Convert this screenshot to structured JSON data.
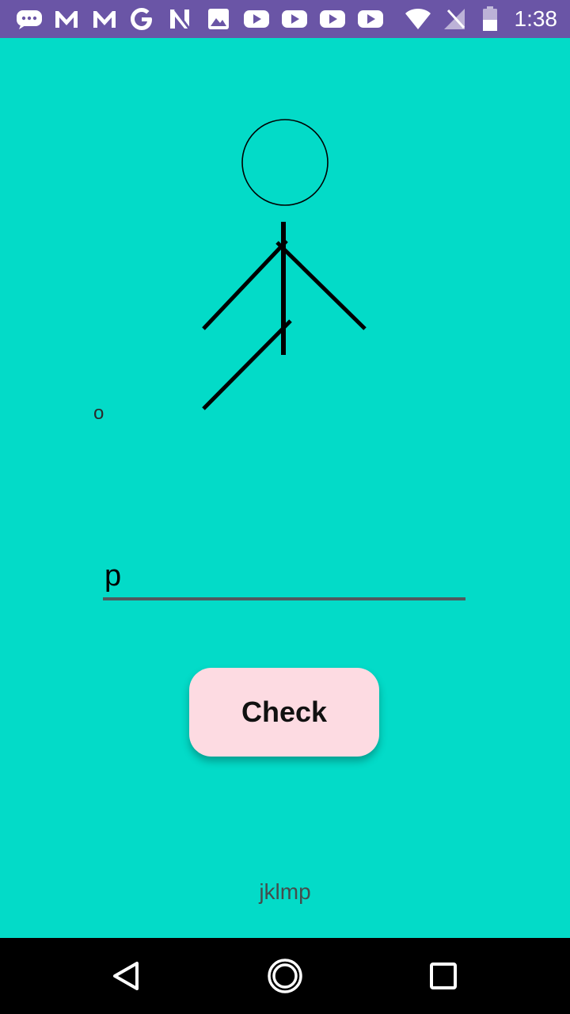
{
  "status_bar": {
    "time": "1:38",
    "icons": [
      "messages-icon",
      "gmail-icon",
      "gmail-icon",
      "google-icon",
      "n-app-icon",
      "gallery-icon",
      "youtube-icon",
      "youtube-icon",
      "youtube-icon",
      "youtube-icon",
      "wifi-icon",
      "no-signal-icon",
      "battery-icon"
    ]
  },
  "game": {
    "guessed_letters": "o",
    "input_value": "p",
    "check_label": "Check",
    "word_display": "jklmp"
  },
  "nav_bar": {
    "icons": [
      "back-icon",
      "home-icon",
      "recents-icon"
    ]
  },
  "colors": {
    "background": "#03dbc8",
    "status_bar": "#6a55a6",
    "button": "#fddbe2"
  }
}
